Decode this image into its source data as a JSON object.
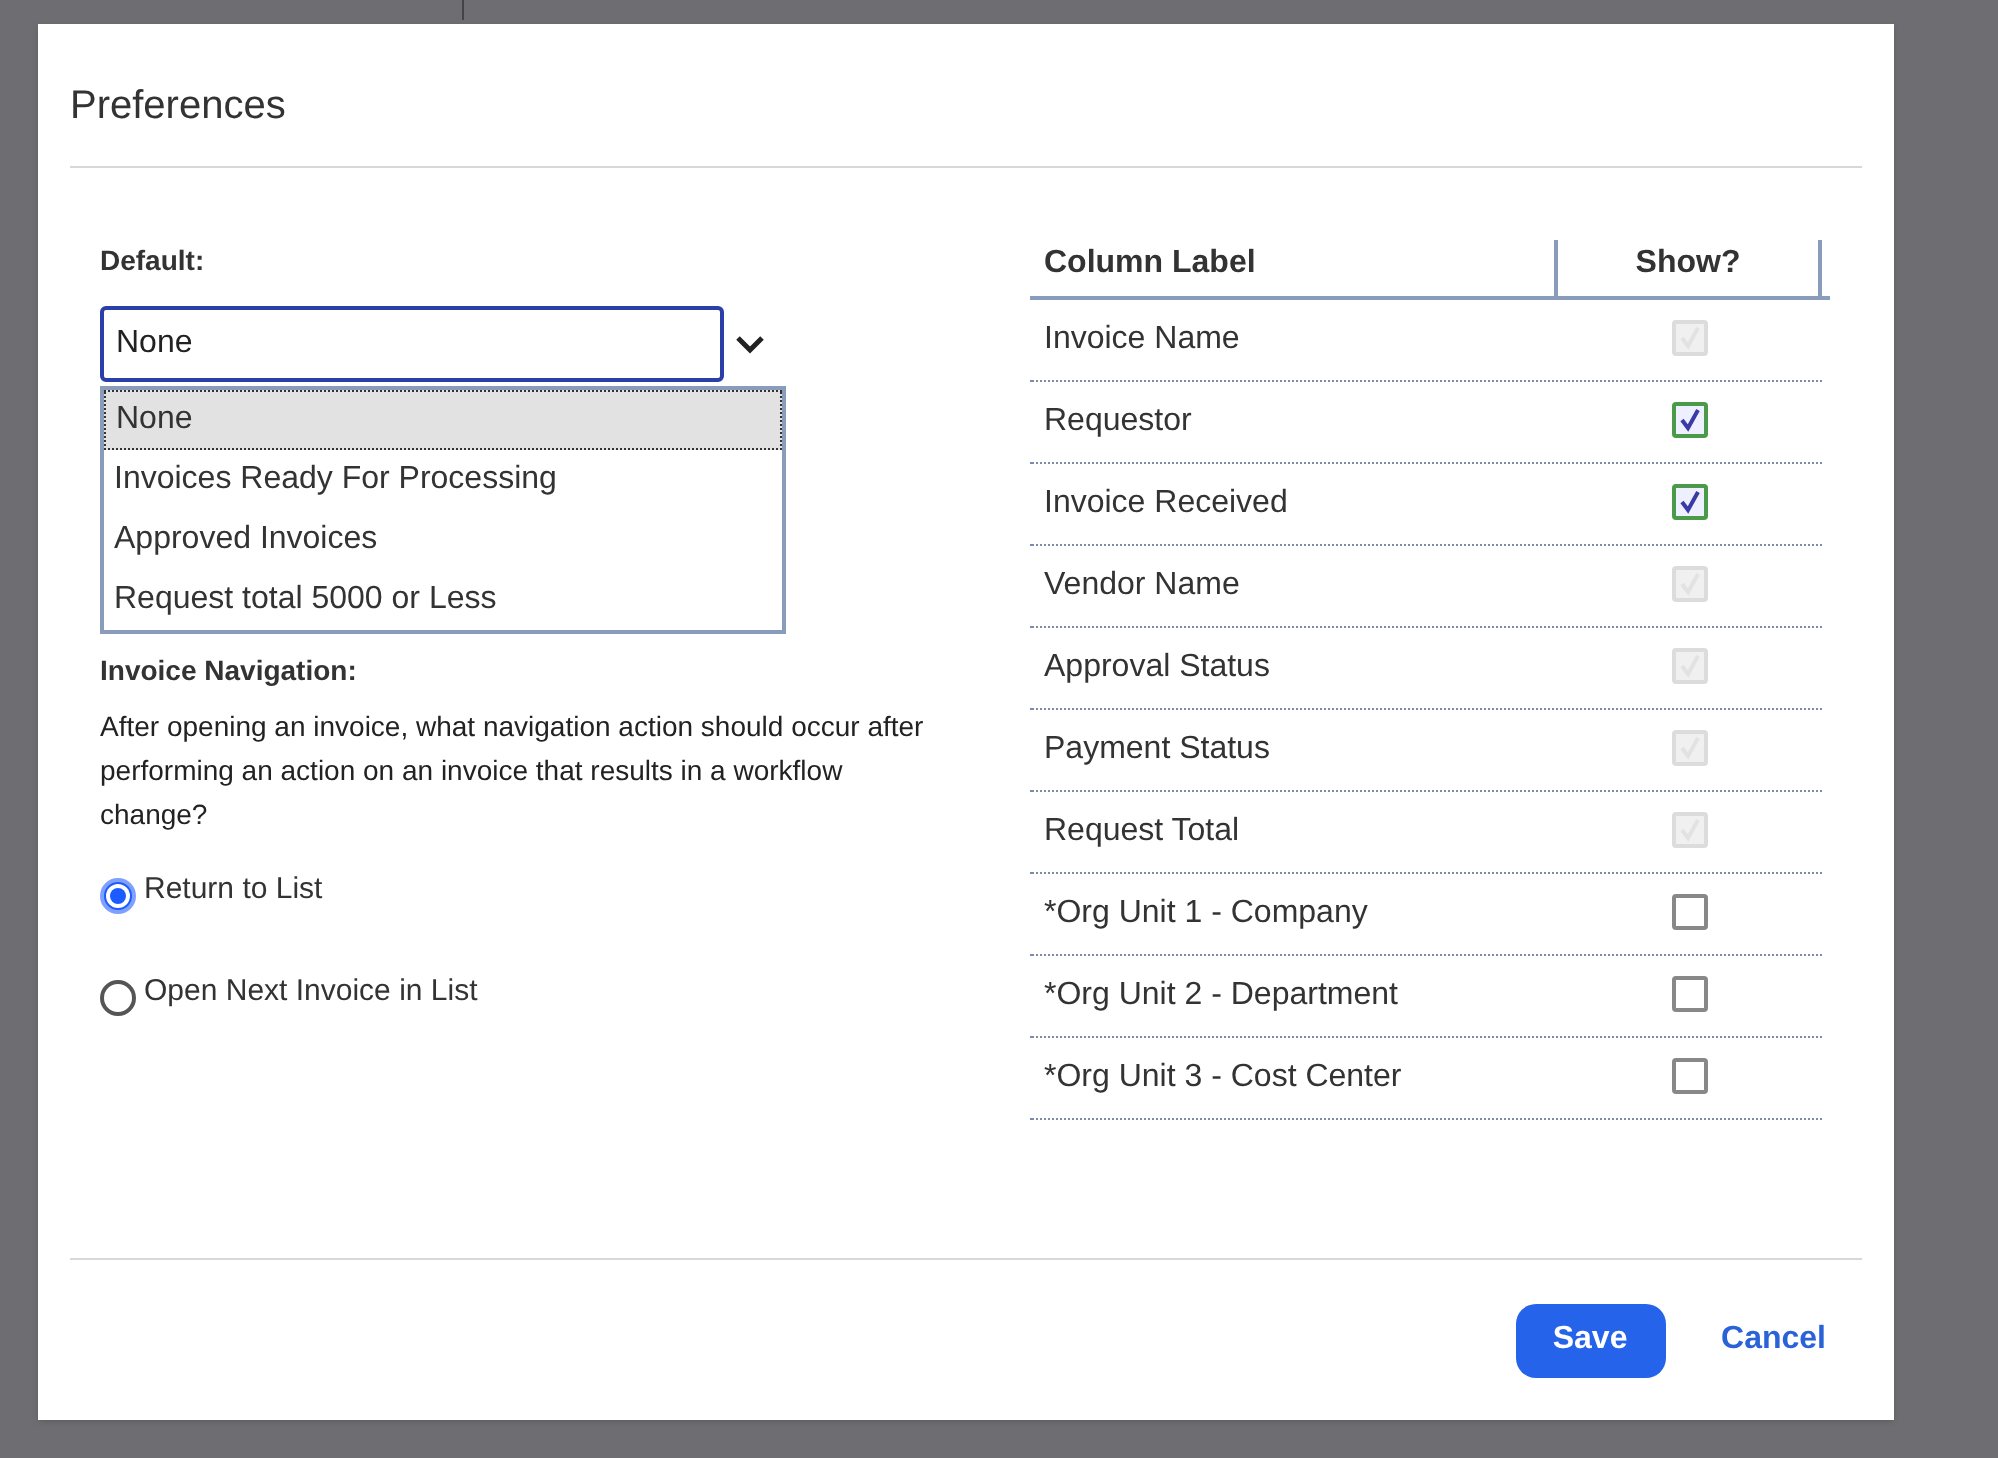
{
  "dialog": {
    "title": "Preferences"
  },
  "default": {
    "label": "Default:",
    "value": "None",
    "options": [
      {
        "label": "None",
        "selected": true
      },
      {
        "label": "Invoices Ready For Processing",
        "selected": false
      },
      {
        "label": "Approved Invoices",
        "selected": false
      },
      {
        "label": "Request total 5000 or Less",
        "selected": false
      }
    ]
  },
  "navigation": {
    "label": "Invoice Navigation:",
    "question": "After opening an invoice, what navigation action should occur after performing an action on an invoice that results in a workflow change?",
    "options": [
      {
        "label": "Return to List",
        "selected": true
      },
      {
        "label": "Open Next Invoice in List",
        "selected": false
      }
    ]
  },
  "table": {
    "columns": [
      "Column Label",
      "Show?"
    ],
    "rows": [
      {
        "label": "Invoice Name",
        "checked": true,
        "disabled": true
      },
      {
        "label": "Requestor",
        "checked": true,
        "disabled": false
      },
      {
        "label": "Invoice Received",
        "checked": true,
        "disabled": false
      },
      {
        "label": "Vendor Name",
        "checked": true,
        "disabled": true
      },
      {
        "label": "Approval Status",
        "checked": true,
        "disabled": true
      },
      {
        "label": "Payment Status",
        "checked": true,
        "disabled": true
      },
      {
        "label": "Request Total",
        "checked": true,
        "disabled": true
      },
      {
        "label": "*Org Unit 1 - Company",
        "checked": false,
        "disabled": false
      },
      {
        "label": "*Org Unit 2 - Department",
        "checked": false,
        "disabled": false
      },
      {
        "label": "*Org Unit 3 - Cost Center",
        "checked": false,
        "disabled": false
      }
    ]
  },
  "buttons": {
    "save": "Save",
    "cancel": "Cancel"
  }
}
